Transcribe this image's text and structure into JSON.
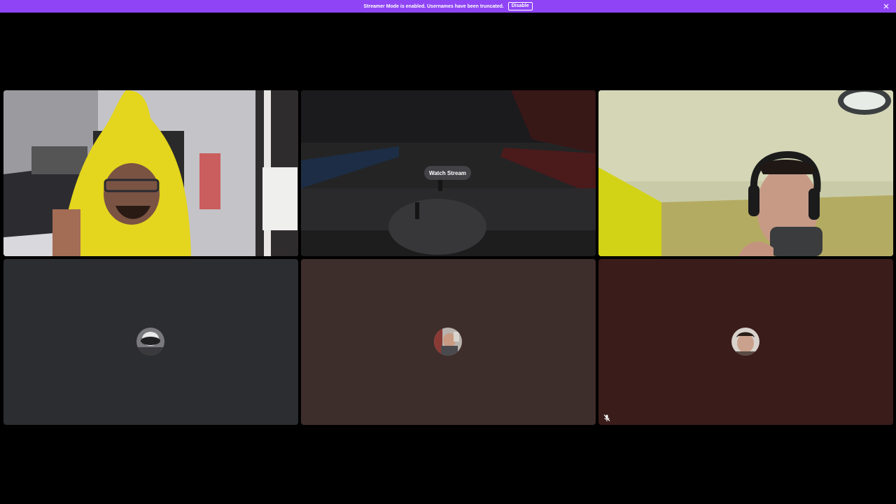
{
  "banner": {
    "message": "Streamer Mode is enabled. Usernames have been truncated.",
    "button_label": "Disable",
    "background": "#8f45f5",
    "close_icon": "close-icon"
  },
  "tiles": [
    {
      "kind": "video",
      "description": "participant-camera-1"
    },
    {
      "kind": "stream",
      "watch_label": "Watch Stream"
    },
    {
      "kind": "video",
      "description": "participant-camera-3"
    },
    {
      "kind": "avatar",
      "background": "#2b2d31"
    },
    {
      "kind": "avatar",
      "background": "#3e2e2b"
    },
    {
      "kind": "avatar",
      "background": "#3a1c1b",
      "status_icon": "mic-muted-icon"
    }
  ]
}
